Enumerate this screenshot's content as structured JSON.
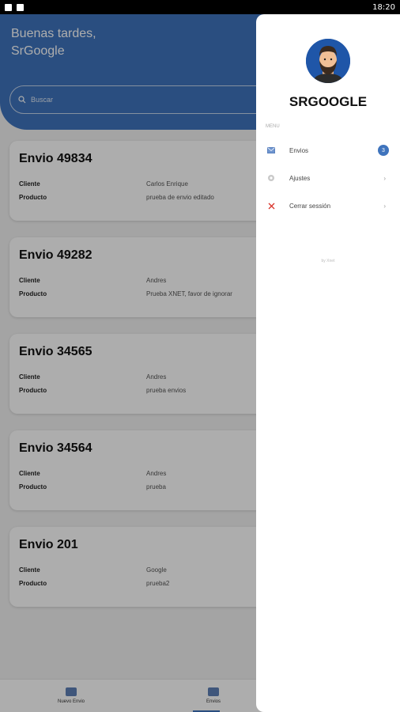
{
  "status_bar": {
    "time": "18:20"
  },
  "header": {
    "greeting_line1": "Buenas tardes,",
    "greeting_line2": "SrGoogle",
    "search_placeholder": "Buscar"
  },
  "shipments": [
    {
      "title": "Envio 49834",
      "client_label": "Cliente",
      "client": "Carlos Enrique",
      "product_label": "Producto",
      "product": "prueba de envio editado"
    },
    {
      "title": "Envio 49282",
      "client_label": "Cliente",
      "client": "Andres",
      "product_label": "Producto",
      "product": "Prueba XNET, favor de ignorar"
    },
    {
      "title": "Envio 34565",
      "client_label": "Cliente",
      "client": "Andres",
      "product_label": "Producto",
      "product": "prueba envios"
    },
    {
      "title": "Envio 34564",
      "client_label": "Cliente",
      "client": "Andres",
      "product_label": "Producto",
      "product": "prueba"
    },
    {
      "title": "Envio 201",
      "client_label": "Cliente",
      "client": "Google",
      "product_label": "Producto",
      "product": "prueba2"
    }
  ],
  "bottom_nav": [
    {
      "label": "Nuevo Envio",
      "icon": "mail-icon"
    },
    {
      "label": "Envios",
      "icon": "box-icon"
    }
  ],
  "drawer": {
    "username": "SRGOOGLE",
    "menu_label": "MENU",
    "items": [
      {
        "label": "Envios",
        "icon": "mail-icon",
        "badge": "3"
      },
      {
        "label": "Ajustes",
        "icon": "gear-icon"
      },
      {
        "label": "Cerrar sessión",
        "icon": "close-icon"
      }
    ],
    "footer": "by Xnet"
  },
  "colors": {
    "primary": "#3f74bd",
    "close": "#d9342b"
  }
}
